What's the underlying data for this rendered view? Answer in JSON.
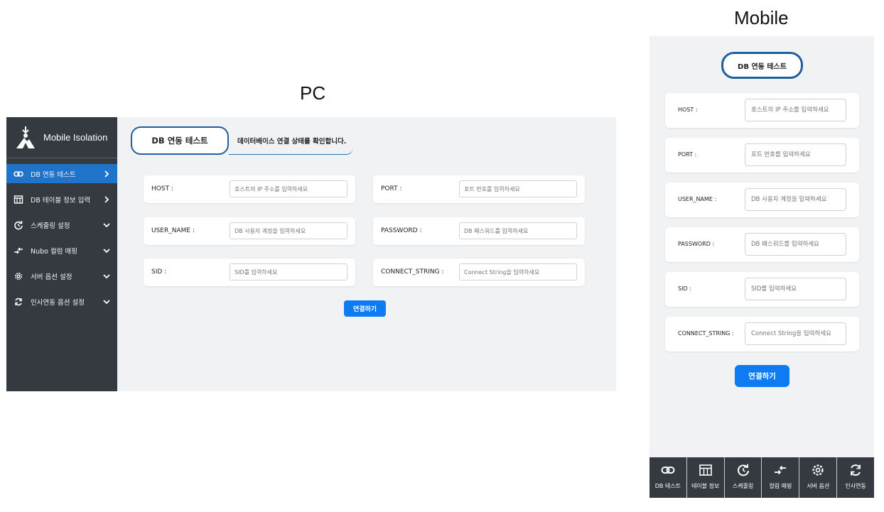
{
  "captions": {
    "pc": "PC",
    "mobile": "Mobile"
  },
  "colors": {
    "sidebar_bg": "#343a40",
    "active_bg": "#1f73c9",
    "accent_blue": "#0d7bf2",
    "pill_border": "#1f5f9e",
    "content_bg": "#f1f2f4"
  },
  "pc": {
    "brand": {
      "title": "Mobile Isolation",
      "logo_icon": "mountain-person-logo"
    },
    "menu": [
      {
        "label": "DB 연동 테스트",
        "icon": "link-icon",
        "arrow": "chevron-right-icon",
        "active": true
      },
      {
        "label": "DB 테이블 정보 입력",
        "icon": "table-icon",
        "arrow": "chevron-right-icon",
        "active": false
      },
      {
        "label": "스케줄링 설정",
        "icon": "refresh-icon",
        "arrow": "chevron-down-icon",
        "active": false
      },
      {
        "label": "Nubo 컬럼 매핑",
        "icon": "mapping-icon",
        "arrow": "chevron-down-icon",
        "active": false
      },
      {
        "label": "서버 옵션 설정",
        "icon": "gear-icon",
        "arrow": "chevron-down-icon",
        "active": false
      },
      {
        "label": "인사연동 옵션 설정",
        "icon": "sync-icon",
        "arrow": "chevron-down-icon",
        "active": false
      }
    ],
    "title": "DB 연동 테스트",
    "subtitle": "데이터베이스 연결 상태를 확인합니다.",
    "fields": [
      {
        "label": "HOST :",
        "placeholder": "호스트의 IP 주소를 입력하세요"
      },
      {
        "label": "PORT :",
        "placeholder": "포트 번호를 입력하세요"
      },
      {
        "label": "USER_NAME :",
        "placeholder": "DB 사용자 계정을 입력하세요"
      },
      {
        "label": "PASSWORD :",
        "placeholder": "DB 패스워드를 입력하세요"
      },
      {
        "label": "SID :",
        "placeholder": "SID를 입력하세요"
      },
      {
        "label": "CONNECT_STRING :",
        "placeholder": "Connect String을 입력하세요"
      }
    ],
    "connect_button": "연결하기"
  },
  "mobile": {
    "title": "DB 연동 테스트",
    "fields": [
      {
        "label": "HOST :",
        "placeholder": "호스트의 IP 주소를 입력하세요"
      },
      {
        "label": "PORT :",
        "placeholder": "포트 번호를 입력하세요"
      },
      {
        "label": "USER_NAME :",
        "placeholder": "DB 사용자 계정을 입력하세요"
      },
      {
        "label": "PASSWORD :",
        "placeholder": "DB 패스워드를 입력하세요"
      },
      {
        "label": "SID :",
        "placeholder": "SID를 입력하세요"
      },
      {
        "label": "CONNECT_STRING :",
        "placeholder": "Connect String을 입력하세요"
      }
    ],
    "connect_button": "연결하기",
    "tabs": [
      {
        "label": "DB 테스트",
        "icon": "link-icon"
      },
      {
        "label": "테이블 정보",
        "icon": "table-icon"
      },
      {
        "label": "스케줄링",
        "icon": "refresh-icon"
      },
      {
        "label": "컬럼 매핑",
        "icon": "mapping-icon"
      },
      {
        "label": "서버 옵션",
        "icon": "gear-icon"
      },
      {
        "label": "인사연동",
        "icon": "sync-icon"
      }
    ]
  }
}
